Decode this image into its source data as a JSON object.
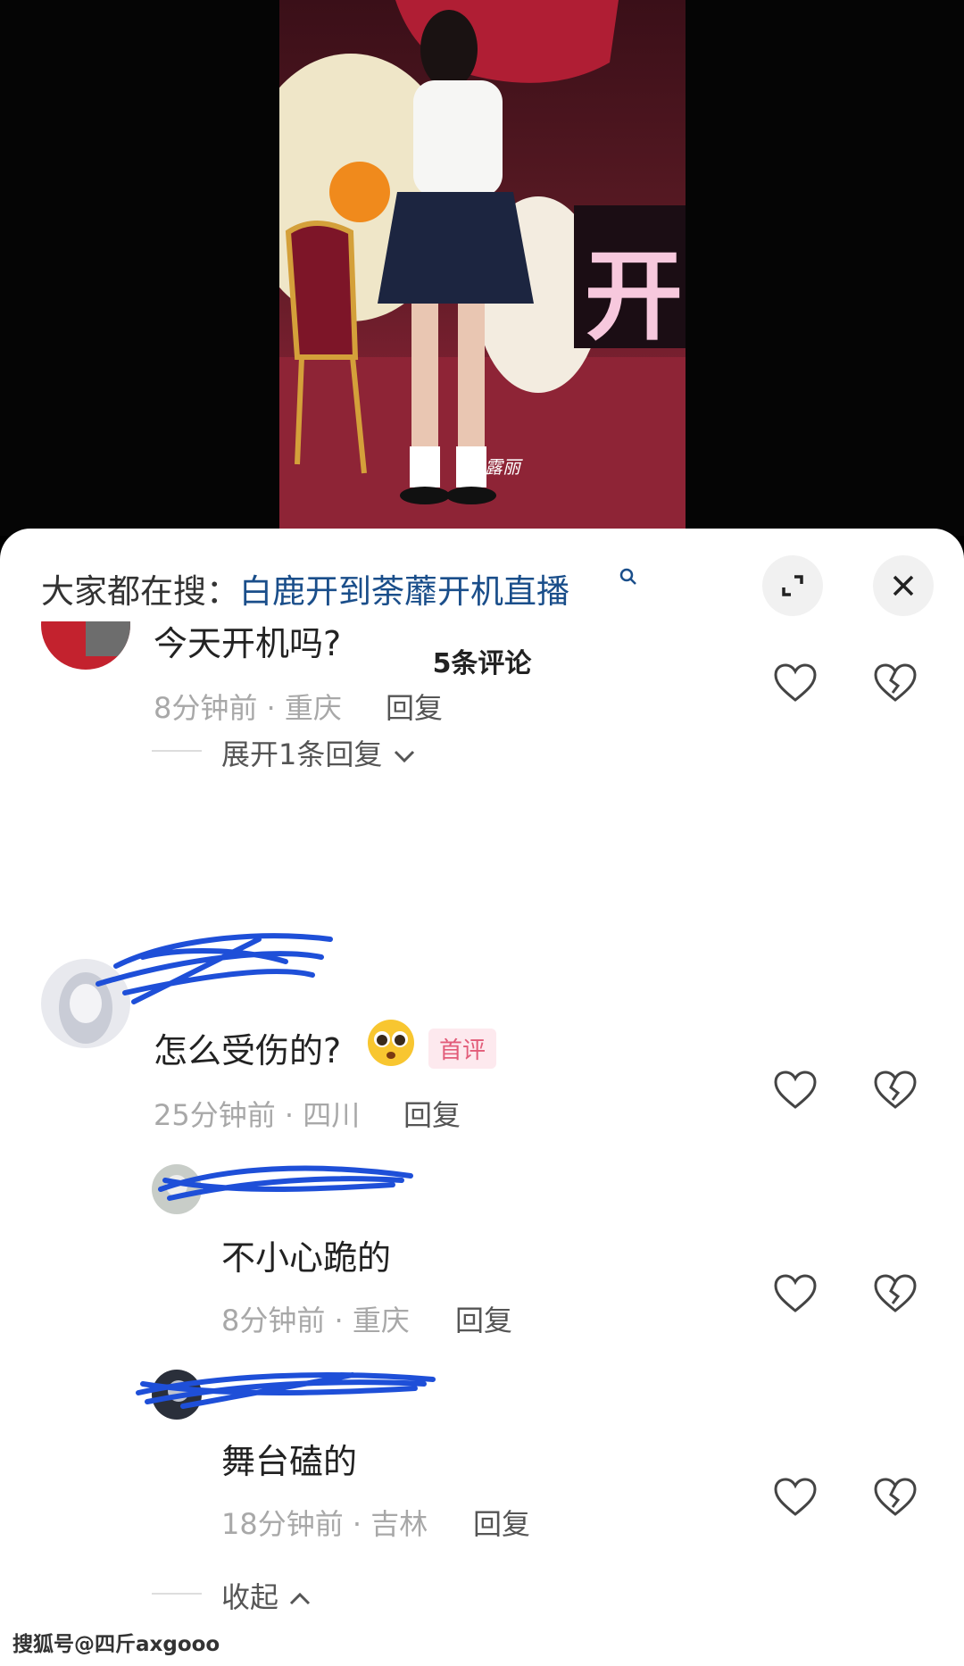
{
  "search_bar": {
    "prefix": "大家都在搜：",
    "query": "白鹿开到荼蘼开机直播"
  },
  "comment_count": "5条评论",
  "video": {
    "overlay_text": "开",
    "caption_watermark": "科露丽"
  },
  "comments": [
    {
      "text": "今天开机吗?",
      "time_location": "8分钟前 · 重庆",
      "reply_label": "回复",
      "expand_label": "展开1条回复"
    },
    {
      "text": "怎么受伤的?",
      "badge": "首评",
      "time_location": "25分钟前 · 四川",
      "reply_label": "回复",
      "replies": [
        {
          "text": "不小心跪的",
          "time_location": "8分钟前 · 重庆",
          "reply_label": "回复"
        },
        {
          "text": "舞台磕的",
          "time_location": "18分钟前 · 吉林",
          "reply_label": "回复"
        }
      ],
      "collapse_label": "收起"
    }
  ],
  "watermark": "搜狐号@四斤axgooo",
  "colors": {
    "link_blue": "#1a4e8a",
    "badge_pink": "#e25c79",
    "scribble_blue": "#1e4fd8"
  }
}
